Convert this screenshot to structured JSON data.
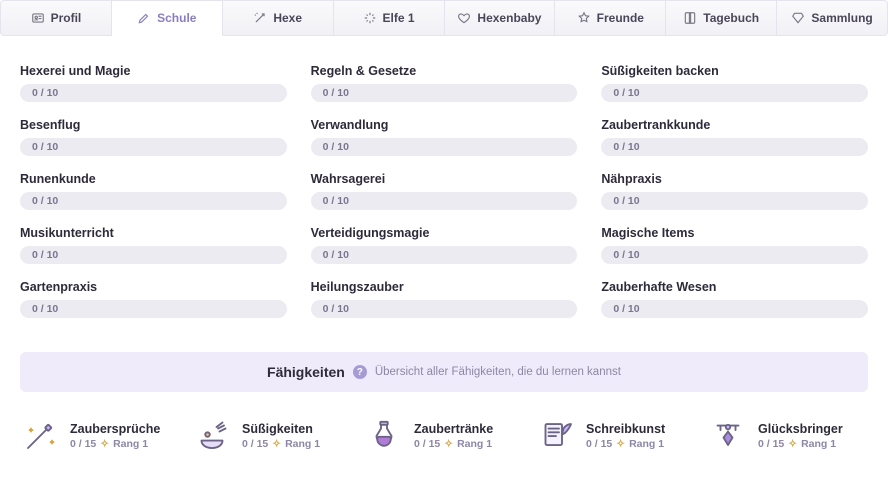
{
  "tabs": [
    {
      "label": "Profil"
    },
    {
      "label": "Schule"
    },
    {
      "label": "Hexe"
    },
    {
      "label": "Elfe 1"
    },
    {
      "label": "Hexenbaby"
    },
    {
      "label": "Freunde"
    },
    {
      "label": "Tagebuch"
    },
    {
      "label": "Sammlung"
    }
  ],
  "skills_col1": [
    {
      "name": "Hexerei und Magie",
      "progress": "0 / 10"
    },
    {
      "name": "Besenflug",
      "progress": "0 / 10"
    },
    {
      "name": "Runenkunde",
      "progress": "0 / 10"
    },
    {
      "name": "Musikunterricht",
      "progress": "0 / 10"
    },
    {
      "name": "Gartenpraxis",
      "progress": "0 / 10"
    }
  ],
  "skills_col2": [
    {
      "name": "Regeln & Gesetze",
      "progress": "0 / 10"
    },
    {
      "name": "Verwandlung",
      "progress": "0 / 10"
    },
    {
      "name": "Wahrsagerei",
      "progress": "0 / 10"
    },
    {
      "name": "Verteidigungsmagie",
      "progress": "0 / 10"
    },
    {
      "name": "Heilungszauber",
      "progress": "0 / 10"
    }
  ],
  "skills_col3": [
    {
      "name": "Süßigkeiten backen",
      "progress": "0 / 10"
    },
    {
      "name": "Zaubertrankkunde",
      "progress": "0 / 10"
    },
    {
      "name": "Nähpraxis",
      "progress": "0 / 10"
    },
    {
      "name": "Magische Items",
      "progress": "0 / 10"
    },
    {
      "name": "Zauberhafte Wesen",
      "progress": "0 / 10"
    }
  ],
  "section": {
    "title": "Fähigkeiten",
    "subtitle": "Übersicht aller Fähigkeiten, die du lernen kannst"
  },
  "abilities": [
    {
      "name": "Zaubersprüche",
      "progress": "0 / 15",
      "rank": "Rang 1"
    },
    {
      "name": "Süßigkeiten",
      "progress": "0 / 15",
      "rank": "Rang 1"
    },
    {
      "name": "Zaubertränke",
      "progress": "0 / 15",
      "rank": "Rang 1"
    },
    {
      "name": "Schreibkunst",
      "progress": "0 / 15",
      "rank": "Rang 1"
    },
    {
      "name": "Glücksbringer",
      "progress": "0 / 15",
      "rank": "Rang 1"
    }
  ]
}
